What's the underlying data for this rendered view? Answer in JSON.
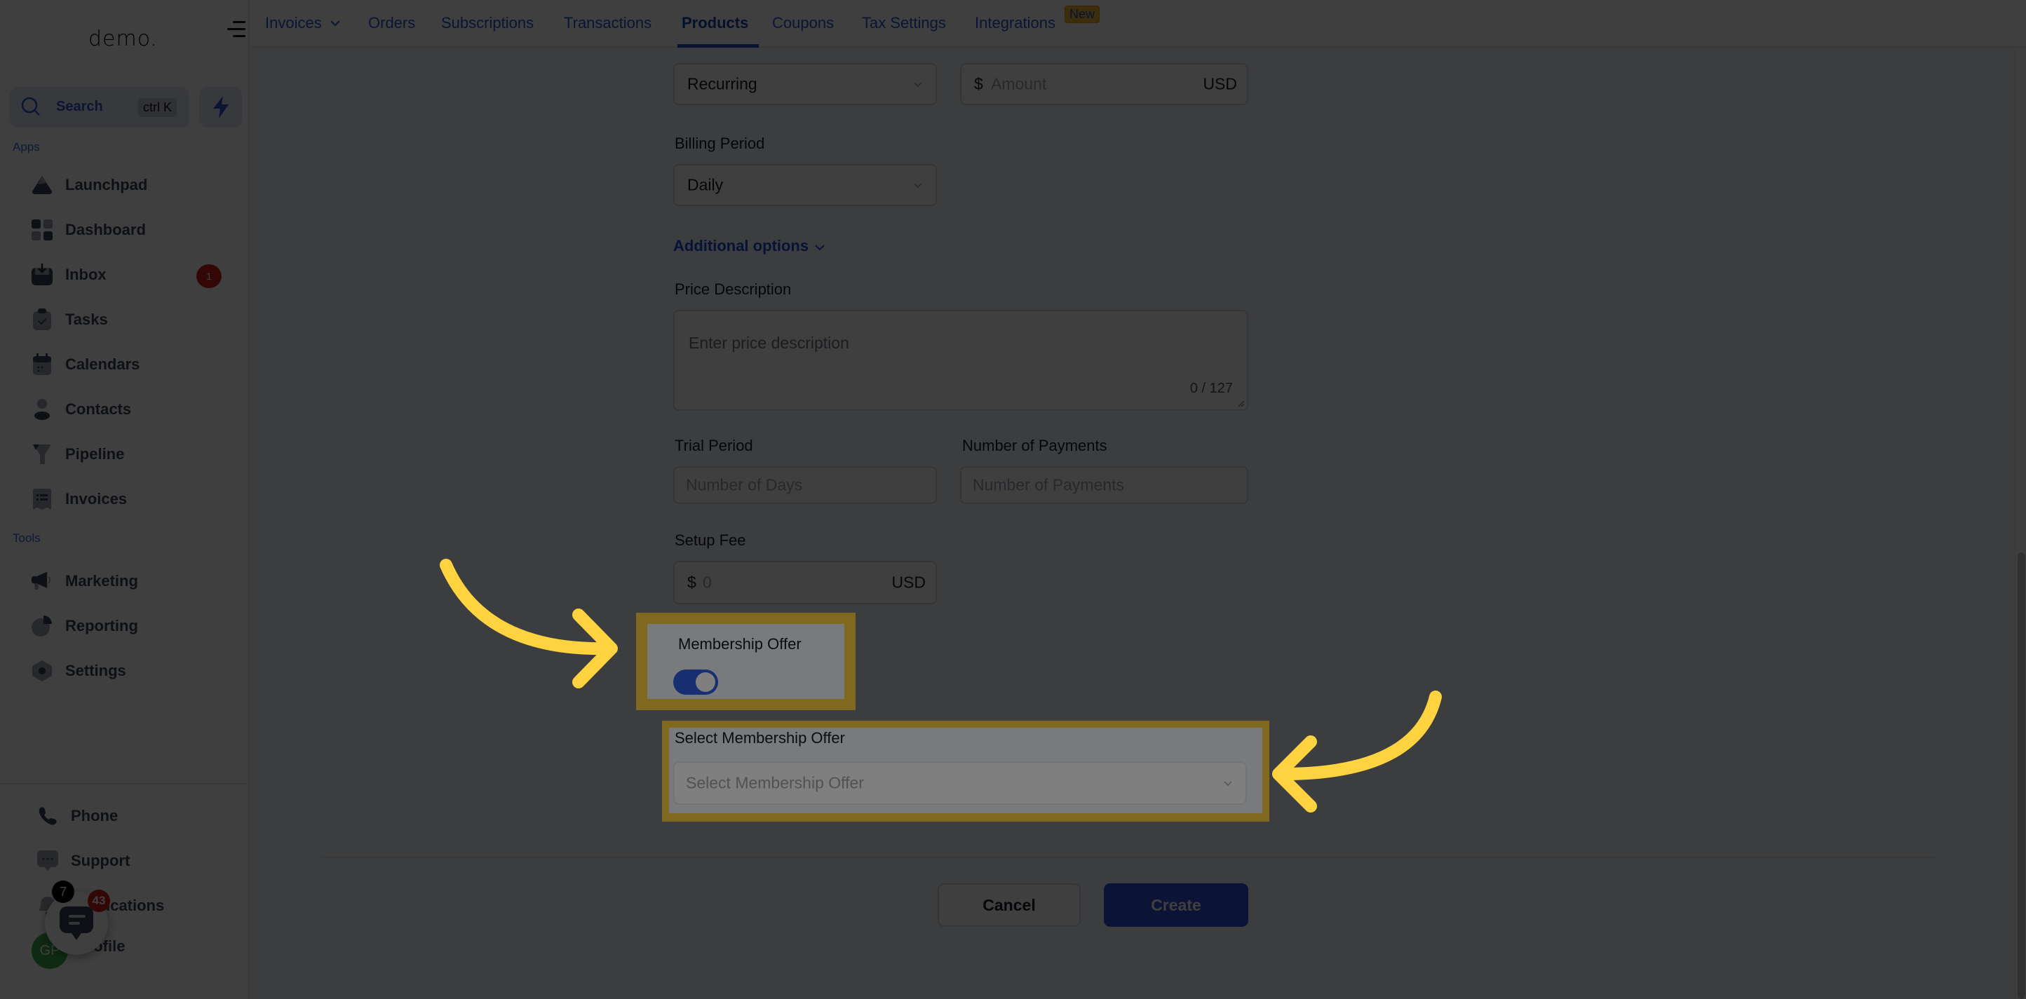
{
  "sidebar": {
    "logo": "demo.",
    "search_label": "Search",
    "search_shortcut": "ctrl K",
    "sections": {
      "apps": "Apps",
      "tools": "Tools"
    },
    "apps": [
      {
        "label": "Launchpad",
        "icon": "rocket-icon"
      },
      {
        "label": "Dashboard",
        "icon": "grid-icon"
      },
      {
        "label": "Inbox",
        "icon": "inbox-icon",
        "badge": "1"
      },
      {
        "label": "Tasks",
        "icon": "clipboard-check-icon"
      },
      {
        "label": "Calendars",
        "icon": "calendar-icon"
      },
      {
        "label": "Contacts",
        "icon": "person-icon"
      },
      {
        "label": "Pipeline",
        "icon": "funnel-icon"
      },
      {
        "label": "Invoices",
        "icon": "receipt-icon"
      }
    ],
    "tools": [
      {
        "label": "Marketing",
        "icon": "megaphone-icon"
      },
      {
        "label": "Reporting",
        "icon": "pie-chart-icon"
      },
      {
        "label": "Settings",
        "icon": "gear-icon"
      }
    ],
    "bottom": [
      {
        "label": "Phone",
        "icon": "phone-icon"
      },
      {
        "label": "Support",
        "icon": "chat-bubble-icon"
      },
      {
        "label": "Notifications",
        "icon": "bell-icon"
      },
      {
        "label": "Profile",
        "icon": "avatar"
      }
    ],
    "notifications_badge": "7",
    "chat_badge": "43",
    "avatar_initials": "GP"
  },
  "topnav": {
    "tabs": [
      {
        "label": "Invoices",
        "dropdown": true
      },
      {
        "label": "Orders"
      },
      {
        "label": "Subscriptions"
      },
      {
        "label": "Transactions"
      },
      {
        "label": "Products",
        "active": true
      },
      {
        "label": "Coupons"
      },
      {
        "label": "Tax Settings"
      },
      {
        "label": "Integrations",
        "badge": "New"
      }
    ]
  },
  "form": {
    "price_type": {
      "value": "Recurring"
    },
    "amount": {
      "currency_symbol": "$",
      "placeholder": "Amount",
      "currency": "USD"
    },
    "billing_period": {
      "label": "Billing Period",
      "value": "Daily"
    },
    "additional_options": "Additional options",
    "price_description": {
      "label": "Price Description",
      "placeholder": "Enter price description",
      "counter": "0 / 127"
    },
    "trial_period": {
      "label": "Trial Period",
      "placeholder": "Number of Days"
    },
    "number_of_payments": {
      "label": "Number of Payments",
      "placeholder": "Number of Payments"
    },
    "setup_fee": {
      "label": "Setup Fee",
      "currency_symbol": "$",
      "placeholder": "0",
      "currency": "USD"
    },
    "membership_offer": {
      "label": "Membership Offer",
      "enabled": true
    },
    "select_membership": {
      "label": "Select Membership Offer",
      "placeholder": "Select Membership Offer"
    },
    "cancel_label": "Cancel",
    "create_label": "Create"
  },
  "colors": {
    "accent": "#2f56c9",
    "primary_button": "#2e4fd8",
    "highlight": "#ffd23f",
    "badge_red": "#d21f1f"
  }
}
